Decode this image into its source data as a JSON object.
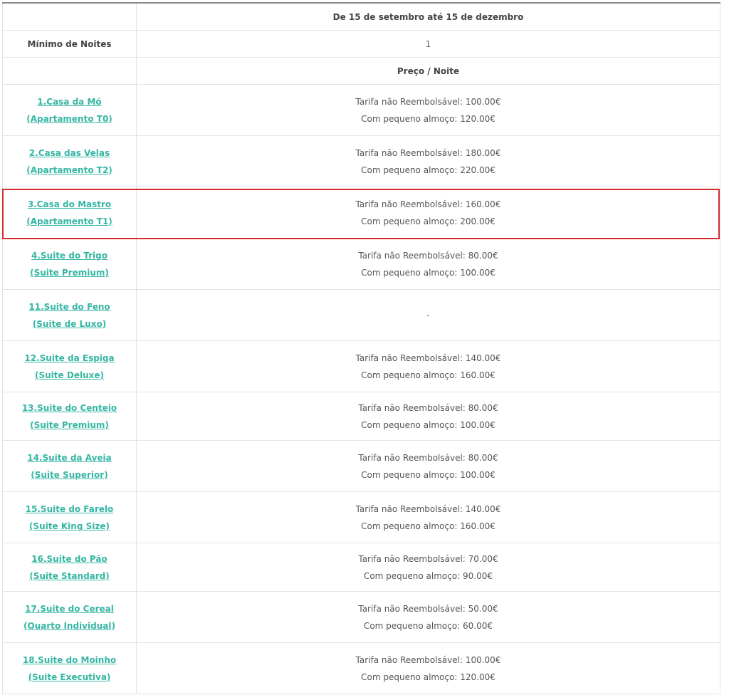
{
  "table": {
    "period_header": "De 15 de setembro até 15 de dezembro",
    "min_nights_label": "Mínimo de Noites",
    "min_nights_value": "1",
    "price_header": "Preço / Noite",
    "rooms": [
      {
        "name": "1.Casa da Mó",
        "type": "(Apartamento T0)",
        "rate_nr": "Tarifa não Reembolsável: 100.00€",
        "rate_bb": "Com pequeno almoço: 120.00€"
      },
      {
        "name": "2.Casa das Velas",
        "type": "(Apartamento T2)",
        "rate_nr": "Tarifa não Reembolsável: 180.00€",
        "rate_bb": "Com pequeno almoço: 220.00€"
      },
      {
        "name": "3.Casa do Mastro",
        "type": "(Apartamento T1)",
        "rate_nr": "Tarifa não Reembolsável: 160.00€",
        "rate_bb": "Com pequeno almoço: 200.00€"
      },
      {
        "name": "4.Suite do Trigo",
        "type": "(Suite Premium)",
        "rate_nr": "Tarifa não Reembolsável: 80.00€",
        "rate_bb": "Com pequeno almoço: 100.00€"
      },
      {
        "name": "11.Suite do Feno",
        "type": "(Suite de Luxo)",
        "unavailable": "-"
      },
      {
        "name": "12.Suite da Espiga",
        "type": "(Suite Deluxe)",
        "rate_nr": "Tarifa não Reembolsável: 140.00€",
        "rate_bb": "Com pequeno almoço: 160.00€"
      },
      {
        "name": "13.Suite do Centeio",
        "type": "(Suite Premium)",
        "rate_nr": "Tarifa não Reembolsável: 80.00€",
        "rate_bb": "Com pequeno almoço: 100.00€"
      },
      {
        "name": "14.Suite da Aveia",
        "type": "(Suite Superior)",
        "rate_nr": "Tarifa não Reembolsável: 80.00€",
        "rate_bb": "Com pequeno almoço: 100.00€"
      },
      {
        "name": "15.Suite do Farelo",
        "type": "(Suite King Size)",
        "rate_nr": "Tarifa não Reembolsável: 140.00€",
        "rate_bb": "Com pequeno almoço: 160.00€"
      },
      {
        "name": "16.Suite do Pão",
        "type": "(Suite Standard)",
        "rate_nr": "Tarifa não Reembolsável: 70.00€",
        "rate_bb": "Com pequeno almoço: 90.00€"
      },
      {
        "name": "17.Suite do Cereal",
        "type": "(Quarto Individual)",
        "rate_nr": "Tarifa não Reembolsável: 50.00€",
        "rate_bb": "Com pequeno almoço: 60.00€"
      },
      {
        "name": "18.Suite do Moinho",
        "type": "(Suite Executiva)",
        "rate_nr": "Tarifa não Reembolsável: 100.00€",
        "rate_bb": "Com pequeno almoço: 120.00€"
      }
    ]
  },
  "colors": {
    "link": "#35b6a4",
    "highlight_border": "#d62c2c",
    "grid": "#e3e3e3"
  }
}
